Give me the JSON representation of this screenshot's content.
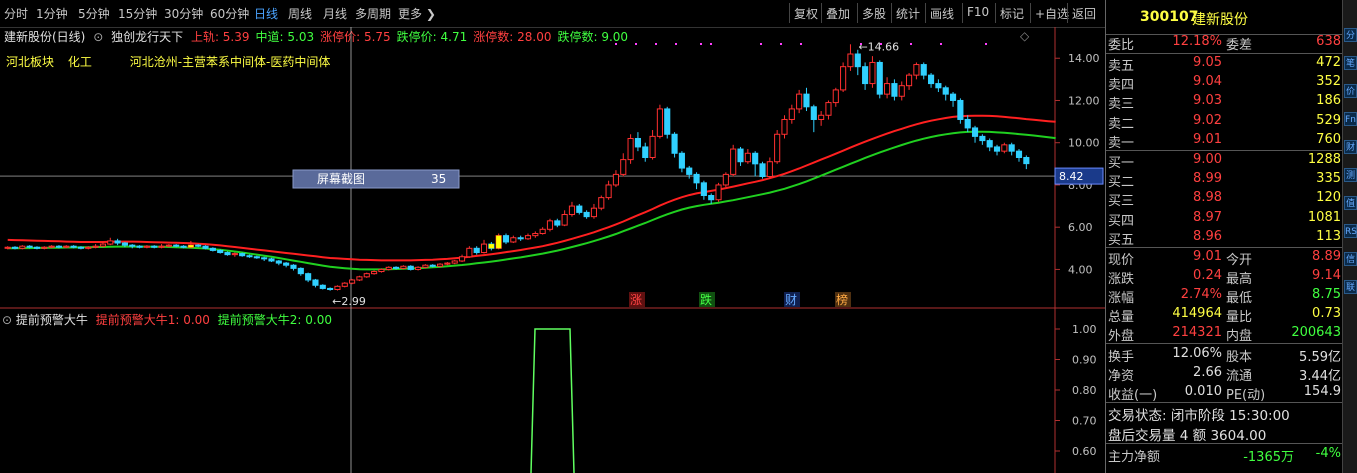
{
  "toolbar": {
    "periods": [
      "分时",
      "1分钟",
      "5分钟",
      "15分钟",
      "30分钟",
      "60分钟",
      "日线",
      "周线",
      "月线",
      "多周期",
      "更多"
    ],
    "active": "日线",
    "tools": [
      "复权",
      "叠加",
      "多股",
      "统计",
      "画线",
      "F10",
      "标记",
      "+自选",
      "返回"
    ]
  },
  "chart": {
    "title": "建新股份(日线)",
    "indicator_name": "独创龙行天下",
    "params": [
      {
        "label": "上轨: 5.39",
        "color": "#ff4040"
      },
      {
        "label": "中道: 5.03",
        "color": "#40ff40"
      },
      {
        "label": "涨停价: 5.75",
        "color": "#ff4040"
      },
      {
        "label": "跌停价: 4.71",
        "color": "#40ff40"
      },
      {
        "label": "涨停数: 28.00",
        "color": "#ff4040"
      },
      {
        "label": "跌停数: 9.00",
        "color": "#40ff40"
      }
    ],
    "sector": [
      "河北板块",
      "化工",
      "河北沧州-主营苯系中间体-医药中间体"
    ],
    "y_ticks": [
      "14.00",
      "12.00",
      "10.00",
      "8.00",
      "6.00",
      "4.00"
    ],
    "crosshair_value": "8.42",
    "high_label": "14.66",
    "low_label": "2.99",
    "tooltip": {
      "label": "屏幕截图",
      "value": "35"
    },
    "markers": [
      {
        "text": "涨",
        "color": "#ff4444",
        "bg": "#601010"
      },
      {
        "text": "跌",
        "color": "#44ff44",
        "bg": "#105010"
      },
      {
        "text": "财",
        "color": "#66aaff",
        "bg": "#102050"
      },
      {
        "text": "榜",
        "color": "#ffaa44",
        "bg": "#503010"
      }
    ],
    "colors": {
      "up": "#ff3030",
      "down": "#30d0ff",
      "upper": "#ff2020",
      "middle": "#20d020",
      "limit": "#ffff00"
    }
  },
  "chart_data": {
    "type": "candlestick",
    "price_range": [
      2.6,
      15.1
    ],
    "high": 14.66,
    "low": 2.99,
    "candles": [
      [
        5.0,
        5.05,
        5.1,
        4.95
      ],
      [
        5.05,
        5.0,
        5.1,
        4.95
      ],
      [
        5.0,
        5.1,
        5.15,
        4.95
      ],
      [
        5.1,
        5.05,
        5.15,
        5.0
      ],
      [
        5.05,
        5.0,
        5.1,
        4.95
      ],
      [
        5.0,
        5.05,
        5.1,
        4.95
      ],
      [
        5.05,
        5.1,
        5.15,
        5.0
      ],
      [
        5.1,
        5.05,
        5.15,
        5.0
      ],
      [
        5.05,
        5.1,
        5.15,
        5.0
      ],
      [
        5.1,
        5.05,
        5.15,
        5.0
      ],
      [
        5.05,
        5.0,
        5.1,
        4.95
      ],
      [
        5.0,
        5.05,
        5.1,
        4.95
      ],
      [
        5.05,
        5.1,
        5.2,
        5.0
      ],
      [
        5.1,
        5.2,
        5.3,
        5.05
      ],
      [
        5.2,
        5.35,
        5.5,
        5.15
      ],
      [
        5.35,
        5.25,
        5.45,
        5.15
      ],
      [
        5.25,
        5.15,
        5.3,
        5.05
      ],
      [
        5.15,
        5.1,
        5.2,
        5.0
      ],
      [
        5.1,
        5.05,
        5.15,
        5.0
      ],
      [
        5.05,
        5.1,
        5.15,
        5.0
      ],
      [
        5.1,
        5.05,
        5.15,
        5.0
      ],
      [
        5.05,
        5.1,
        5.2,
        5.0
      ],
      [
        5.1,
        5.15,
        5.2,
        5.05
      ],
      [
        5.15,
        5.1,
        5.2,
        5.05
      ],
      [
        5.1,
        5.05,
        5.15,
        5.0
      ],
      [
        5.05,
        5.15,
        5.35,
        5.0
      ],
      [
        5.15,
        5.1,
        5.2,
        5.05
      ],
      [
        5.1,
        5.0,
        5.15,
        4.95
      ],
      [
        5.0,
        4.9,
        5.05,
        4.85
      ],
      [
        4.9,
        4.8,
        4.95,
        4.75
      ],
      [
        4.8,
        4.7,
        4.85,
        4.65
      ],
      [
        4.7,
        4.75,
        4.8,
        4.6
      ],
      [
        4.75,
        4.65,
        4.8,
        4.6
      ],
      [
        4.65,
        4.6,
        4.7,
        4.55
      ],
      [
        4.6,
        4.55,
        4.65,
        4.5
      ],
      [
        4.55,
        4.5,
        4.6,
        4.4
      ],
      [
        4.5,
        4.4,
        4.55,
        4.35
      ],
      [
        4.4,
        4.3,
        4.45,
        4.2
      ],
      [
        4.3,
        4.2,
        4.35,
        4.1
      ],
      [
        4.2,
        4.05,
        4.25,
        3.95
      ],
      [
        4.05,
        3.8,
        4.1,
        3.7
      ],
      [
        3.8,
        3.5,
        3.85,
        3.4
      ],
      [
        3.5,
        3.25,
        3.55,
        3.15
      ],
      [
        3.25,
        3.1,
        3.3,
        3.05
      ],
      [
        3.1,
        3.05,
        3.15,
        2.99
      ],
      [
        3.05,
        3.2,
        3.25,
        3.0
      ],
      [
        3.2,
        3.35,
        3.4,
        3.15
      ],
      [
        3.35,
        3.5,
        3.55,
        3.3
      ],
      [
        3.5,
        3.65,
        3.7,
        3.45
      ],
      [
        3.65,
        3.8,
        3.85,
        3.6
      ],
      [
        3.8,
        3.9,
        3.95,
        3.75
      ],
      [
        3.9,
        4.0,
        4.05,
        3.85
      ],
      [
        4.0,
        4.1,
        4.15,
        3.95
      ],
      [
        4.1,
        4.05,
        4.15,
        4.0
      ],
      [
        4.05,
        4.15,
        4.2,
        4.0
      ],
      [
        4.15,
        4.0,
        4.2,
        3.95
      ],
      [
        4.0,
        4.1,
        4.15,
        3.95
      ],
      [
        4.1,
        4.2,
        4.25,
        4.05
      ],
      [
        4.2,
        4.15,
        4.25,
        4.1
      ],
      [
        4.15,
        4.25,
        4.3,
        4.1
      ],
      [
        4.25,
        4.3,
        4.35,
        4.2
      ],
      [
        4.3,
        4.4,
        4.45,
        4.25
      ],
      [
        4.4,
        4.6,
        4.7,
        4.35
      ],
      [
        4.6,
        5.0,
        5.1,
        4.55
      ],
      [
        5.0,
        4.8,
        5.1,
        4.7
      ],
      [
        4.8,
        5.2,
        5.4,
        4.75
      ],
      [
        5.2,
        5.0,
        5.3,
        4.9
      ],
      [
        5.0,
        5.6,
        5.7,
        4.95
      ],
      [
        5.6,
        5.3,
        5.7,
        5.2
      ],
      [
        5.3,
        5.5,
        5.6,
        5.25
      ],
      [
        5.5,
        5.45,
        5.6,
        5.35
      ],
      [
        5.45,
        5.6,
        5.7,
        5.4
      ],
      [
        5.6,
        5.7,
        5.8,
        5.5
      ],
      [
        5.7,
        5.9,
        6.0,
        5.65
      ],
      [
        5.9,
        6.3,
        6.4,
        5.8
      ],
      [
        6.3,
        6.1,
        6.4,
        6.0
      ],
      [
        6.1,
        6.6,
        6.8,
        6.05
      ],
      [
        6.6,
        7.0,
        7.2,
        6.5
      ],
      [
        7.0,
        6.7,
        7.1,
        6.6
      ],
      [
        6.7,
        6.5,
        6.8,
        6.4
      ],
      [
        6.5,
        6.9,
        7.1,
        6.4
      ],
      [
        6.9,
        7.4,
        7.5,
        6.8
      ],
      [
        7.4,
        8.0,
        8.2,
        7.3
      ],
      [
        8.0,
        8.5,
        8.7,
        7.9
      ],
      [
        8.5,
        9.2,
        9.5,
        8.4
      ],
      [
        9.2,
        10.2,
        10.4,
        9.0
      ],
      [
        10.2,
        9.8,
        10.5,
        9.6
      ],
      [
        9.8,
        9.3,
        10.0,
        9.1
      ],
      [
        9.3,
        10.3,
        10.6,
        9.2
      ],
      [
        10.3,
        11.6,
        11.8,
        10.2
      ],
      [
        11.6,
        10.4,
        11.7,
        10.2
      ],
      [
        10.4,
        9.5,
        10.5,
        9.3
      ],
      [
        9.5,
        8.8,
        9.6,
        8.6
      ],
      [
        8.8,
        8.5,
        8.9,
        8.3
      ],
      [
        8.5,
        8.1,
        8.6,
        7.8
      ],
      [
        8.1,
        7.5,
        8.2,
        7.3
      ],
      [
        7.5,
        7.3,
        7.6,
        7.1
      ],
      [
        7.3,
        8.0,
        8.1,
        7.2
      ],
      [
        8.0,
        8.5,
        8.6,
        7.9
      ],
      [
        8.5,
        9.7,
        9.9,
        8.4
      ],
      [
        9.7,
        9.1,
        9.8,
        8.9
      ],
      [
        9.1,
        9.5,
        9.7,
        9.0
      ],
      [
        9.5,
        9.0,
        9.6,
        8.4
      ],
      [
        9.0,
        8.4,
        9.1,
        8.3
      ],
      [
        8.4,
        9.1,
        9.3,
        8.3
      ],
      [
        9.1,
        10.4,
        10.6,
        9.0
      ],
      [
        10.4,
        11.1,
        11.3,
        10.2
      ],
      [
        11.1,
        11.6,
        11.8,
        10.9
      ],
      [
        11.6,
        12.3,
        12.5,
        11.4
      ],
      [
        12.3,
        11.7,
        12.6,
        11.5
      ],
      [
        11.7,
        11.1,
        11.8,
        10.5
      ],
      [
        11.1,
        11.3,
        11.5,
        10.8
      ],
      [
        11.3,
        11.9,
        12.0,
        11.1
      ],
      [
        11.9,
        12.5,
        12.6,
        11.7
      ],
      [
        12.5,
        13.6,
        13.8,
        12.4
      ],
      [
        13.6,
        14.2,
        14.66,
        13.4
      ],
      [
        14.2,
        13.6,
        14.4,
        13.2
      ],
      [
        13.6,
        12.8,
        13.8,
        12.5
      ],
      [
        12.8,
        13.8,
        14.1,
        12.6
      ],
      [
        13.8,
        12.3,
        13.9,
        12.1
      ],
      [
        12.3,
        12.8,
        13.1,
        12.1
      ],
      [
        12.8,
        12.2,
        13.0,
        12.0
      ],
      [
        12.2,
        12.7,
        12.9,
        12.0
      ],
      [
        12.7,
        13.2,
        13.3,
        12.5
      ],
      [
        13.2,
        13.7,
        13.8,
        13.0
      ],
      [
        13.7,
        13.2,
        13.8,
        13.0
      ],
      [
        13.2,
        12.8,
        13.3,
        12.6
      ],
      [
        12.8,
        12.6,
        13.0,
        12.4
      ],
      [
        12.6,
        12.3,
        12.7,
        12.0
      ],
      [
        12.3,
        12.0,
        12.4,
        11.7
      ],
      [
        12.0,
        11.1,
        12.1,
        10.9
      ],
      [
        11.1,
        10.7,
        11.3,
        10.5
      ],
      [
        10.7,
        10.3,
        10.8,
        10.0
      ],
      [
        10.3,
        10.1,
        10.4,
        9.9
      ],
      [
        10.1,
        9.8,
        10.2,
        9.6
      ],
      [
        9.8,
        9.6,
        9.9,
        9.4
      ],
      [
        9.6,
        9.9,
        10.0,
        9.5
      ],
      [
        9.9,
        9.6,
        10.0,
        9.4
      ],
      [
        9.6,
        9.3,
        9.7,
        9.1
      ],
      [
        9.3,
        9.01,
        9.4,
        8.75
      ]
    ],
    "upper_band": [
      5.4,
      5.39,
      5.38,
      5.37,
      5.36,
      5.35,
      5.34,
      5.33,
      5.32,
      5.31,
      5.3,
      5.3,
      5.3,
      5.3,
      5.31,
      5.32,
      5.32,
      5.32,
      5.31,
      5.3,
      5.29,
      5.28,
      5.27,
      5.26,
      5.25,
      5.24,
      5.22,
      5.2,
      5.17,
      5.14,
      5.1,
      5.06,
      5.02,
      4.98,
      4.94,
      4.9,
      4.86,
      4.82,
      4.78,
      4.74,
      4.7,
      4.66,
      4.62,
      4.58,
      4.54,
      4.52,
      4.5,
      4.48,
      4.46,
      4.45,
      4.44,
      4.43,
      4.43,
      4.43,
      4.43,
      4.43,
      4.44,
      4.45,
      4.46,
      4.48,
      4.5,
      4.53,
      4.56,
      4.6,
      4.64,
      4.68,
      4.72,
      4.77,
      4.82,
      4.87,
      4.92,
      4.98,
      5.04,
      5.1,
      5.18,
      5.26,
      5.35,
      5.45,
      5.55,
      5.65,
      5.76,
      5.88,
      6.0,
      6.13,
      6.27,
      6.42,
      6.57,
      6.71,
      6.86,
      7.02,
      7.17,
      7.3,
      7.42,
      7.52,
      7.6,
      7.66,
      7.72,
      7.78,
      7.85,
      7.92,
      8.0,
      8.08,
      8.15,
      8.23,
      8.32,
      8.42,
      8.53,
      8.65,
      8.78,
      8.92,
      9.06,
      9.2,
      9.34,
      9.48,
      9.62,
      9.77,
      9.91,
      10.05,
      10.18,
      10.31,
      10.43,
      10.55,
      10.66,
      10.77,
      10.87,
      10.96,
      11.04,
      11.11,
      11.17,
      11.22,
      11.25,
      11.27,
      11.28,
      11.28,
      11.27,
      11.25,
      11.22,
      11.19,
      11.16,
      11.12,
      11.09,
      11.05,
      11.02,
      10.99
    ],
    "middle_band": [
      5.0,
      5.0,
      5.01,
      5.01,
      5.02,
      5.02,
      5.03,
      5.03,
      5.04,
      5.04,
      5.05,
      5.05,
      5.06,
      5.06,
      5.07,
      5.08,
      5.08,
      5.08,
      5.08,
      5.08,
      5.07,
      5.07,
      5.06,
      5.05,
      5.04,
      5.03,
      5.01,
      4.99,
      4.96,
      4.93,
      4.89,
      4.85,
      4.8,
      4.75,
      4.7,
      4.65,
      4.6,
      4.54,
      4.48,
      4.42,
      4.36,
      4.3,
      4.24,
      4.18,
      4.13,
      4.09,
      4.06,
      4.03,
      4.01,
      4.0,
      4.0,
      4.0,
      4.01,
      4.02,
      4.03,
      4.05,
      4.06,
      4.08,
      4.1,
      4.12,
      4.15,
      4.18,
      4.21,
      4.25,
      4.29,
      4.33,
      4.37,
      4.42,
      4.47,
      4.52,
      4.57,
      4.63,
      4.69,
      4.75,
      4.82,
      4.89,
      4.97,
      5.06,
      5.15,
      5.24,
      5.34,
      5.45,
      5.56,
      5.68,
      5.81,
      5.94,
      6.07,
      6.2,
      6.34,
      6.48,
      6.61,
      6.73,
      6.84,
      6.93,
      7.0,
      7.06,
      7.11,
      7.16,
      7.22,
      7.28,
      7.35,
      7.42,
      7.49,
      7.56,
      7.64,
      7.73,
      7.82,
      7.93,
      8.04,
      8.17,
      8.3,
      8.44,
      8.58,
      8.72,
      8.86,
      9.0,
      9.14,
      9.28,
      9.41,
      9.54,
      9.66,
      9.78,
      9.89,
      10.0,
      10.1,
      10.19,
      10.27,
      10.34,
      10.4,
      10.45,
      10.49,
      10.51,
      10.52,
      10.52,
      10.51,
      10.49,
      10.47,
      10.44,
      10.41,
      10.38,
      10.34,
      10.3,
      10.26,
      10.22
    ],
    "sub_indicator": {
      "name": "提前预警大牛",
      "lines": [
        {
          "name": "提前预警大牛1",
          "value": 0.0
        },
        {
          "name": "提前预警大牛2",
          "value": 0.0
        }
      ],
      "y_ticks": [
        "1.00",
        "0.90",
        "0.80",
        "0.70",
        "0.60"
      ]
    }
  },
  "sub": {
    "name": "提前预警大牛",
    "l1": "提前预警大牛1: 0.00",
    "l2": "提前预警大牛2: 0.00"
  },
  "panel": {
    "code": "300107",
    "name": "建新股份",
    "weibi": {
      "label": "委比",
      "value": "12.18%",
      "label2": "委差",
      "value2": "638"
    },
    "sell": [
      {
        "label": "卖五",
        "price": "9.05",
        "qty": "472"
      },
      {
        "label": "卖四",
        "price": "9.04",
        "qty": "352"
      },
      {
        "label": "卖三",
        "price": "9.03",
        "qty": "186"
      },
      {
        "label": "卖二",
        "price": "9.02",
        "qty": "529"
      },
      {
        "label": "卖一",
        "price": "9.01",
        "qty": "760"
      }
    ],
    "buy": [
      {
        "label": "买一",
        "price": "9.00",
        "qty": "1288"
      },
      {
        "label": "买二",
        "price": "8.99",
        "qty": "335"
      },
      {
        "label": "买三",
        "price": "8.98",
        "qty": "120"
      },
      {
        "label": "买四",
        "price": "8.97",
        "qty": "1081"
      },
      {
        "label": "买五",
        "price": "8.96",
        "qty": "113"
      }
    ],
    "stats": [
      {
        "l1": "现价",
        "v1": "9.01",
        "c1": "r",
        "l2": "今开",
        "v2": "8.89",
        "c2": "r"
      },
      {
        "l1": "涨跌",
        "v1": "0.24",
        "c1": "r",
        "l2": "最高",
        "v2": "9.14",
        "c2": "r"
      },
      {
        "l1": "涨幅",
        "v1": "2.74%",
        "c1": "r",
        "l2": "最低",
        "v2": "8.75",
        "c2": "g"
      },
      {
        "l1": "总量",
        "v1": "414964",
        "c1": "y",
        "l2": "量比",
        "v2": "0.73",
        "c2": "y"
      },
      {
        "l1": "外盘",
        "v1": "214321",
        "c1": "r",
        "l2": "内盘",
        "v2": "200643",
        "c2": "g"
      }
    ],
    "stats2": [
      {
        "l1": "换手",
        "v1": "12.06%",
        "l2": "股本",
        "v2": "5.59亿"
      },
      {
        "l1": "净资",
        "v1": "2.66",
        "l2": "流通",
        "v2": "3.44亿"
      },
      {
        "l1": "收益(一)",
        "v1": "0.010",
        "l2": "PE(动)",
        "v2": "154.9"
      }
    ],
    "trade_state": "交易状态: 闭市阶段 15:30:00",
    "after_hours": "盘后交易量 4 额 3604.00",
    "main_flow": {
      "label": "主力净额",
      "value": "-1365万",
      "pct": "-4%"
    }
  },
  "side_icons": [
    "分",
    "笔",
    "价",
    "Fn",
    "财",
    "测",
    "值",
    "RS",
    "信",
    "联"
  ]
}
